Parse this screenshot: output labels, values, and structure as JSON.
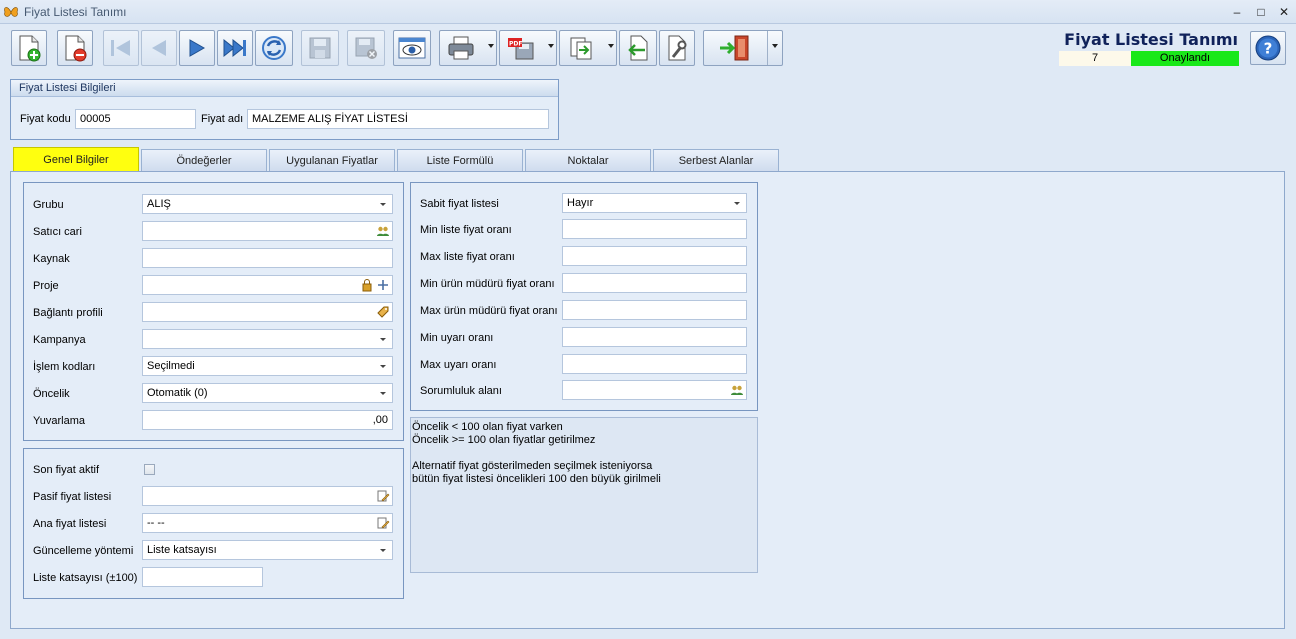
{
  "window": {
    "title": "Fiyat Listesi Tanımı",
    "controls": {
      "minimize": "–",
      "maximize": "□",
      "close": "✕"
    }
  },
  "toolbar": {
    "buttons": [
      "new-icon",
      "delete-icon",
      "first-icon",
      "prev-icon",
      "next-icon",
      "last-icon",
      "refresh-icon",
      "save-icon",
      "save-close-icon",
      "preview-icon",
      "print-icon",
      "pdf-icon",
      "export-icon",
      "import-icon",
      "tools-icon",
      "exit-icon"
    ]
  },
  "header": {
    "title": "Fiyat Listesi Tanımı",
    "record_no": "7",
    "status": "Onaylandı",
    "status_color": "#19e819"
  },
  "info_box": {
    "title": "Fiyat Listesi Bilgileri",
    "code_label": "Fiyat kodu",
    "code_value": "00005",
    "name_label": "Fiyat adı",
    "name_value": "MALZEME ALIŞ FİYAT LİSTESİ"
  },
  "tabs": [
    {
      "label": "Genel Bilgiler",
      "active": true
    },
    {
      "label": "Öndeğerler"
    },
    {
      "label": "Uygulanan Fiyatlar"
    },
    {
      "label": "Liste Formülü"
    },
    {
      "label": "Noktalar"
    },
    {
      "label": "Serbest Alanlar"
    }
  ],
  "left_fields": [
    {
      "label": "Grubu",
      "value": "ALIŞ"
    },
    {
      "label": "Satıcı cari",
      "value": ""
    },
    {
      "label": "Kaynak",
      "value": ""
    },
    {
      "label": "Proje",
      "value": ""
    },
    {
      "label": "Bağlantı profili",
      "value": ""
    },
    {
      "label": "Kampanya",
      "value": ""
    },
    {
      "label": "İşlem kodları",
      "value": "Seçilmedi"
    },
    {
      "label": "Öncelik",
      "value": "Otomatik (0)"
    },
    {
      "label": "Yuvarlama",
      "value": ",00"
    }
  ],
  "lower_fields": [
    {
      "label": "Son fiyat aktif",
      "checked": false
    },
    {
      "label": "Pasif fiyat listesi",
      "value": ""
    },
    {
      "label": "Ana fiyat listesi",
      "value": "-- --"
    },
    {
      "label": "Güncelleme yöntemi",
      "value": "Liste katsayısı"
    },
    {
      "label": "Liste katsayısı (±100)",
      "value": ""
    }
  ],
  "right_fields": [
    {
      "label": "Sabit fiyat listesi",
      "value": "Hayır"
    },
    {
      "label": "Min liste fiyat oranı",
      "value": ""
    },
    {
      "label": "Max liste fiyat oranı",
      "value": ""
    },
    {
      "label": "Min ürün müdürü fiyat oranı",
      "value": ""
    },
    {
      "label": "Max ürün müdürü fiyat oranı",
      "value": ""
    },
    {
      "label": "Min uyarı oranı",
      "value": ""
    },
    {
      "label": "Max uyarı oranı",
      "value": ""
    },
    {
      "label": "Sorumluluk alanı",
      "value": ""
    }
  ],
  "notes": [
    "Öncelik < 100 olan fiyat varken",
    "Öncelik >= 100 olan fiyatlar getirilmez",
    "",
    "Alternatif fiyat gösterilmeden seçilmek isteniyorsa",
    "bütün fiyat listesi öncelikleri 100 den büyük girilmeli"
  ]
}
